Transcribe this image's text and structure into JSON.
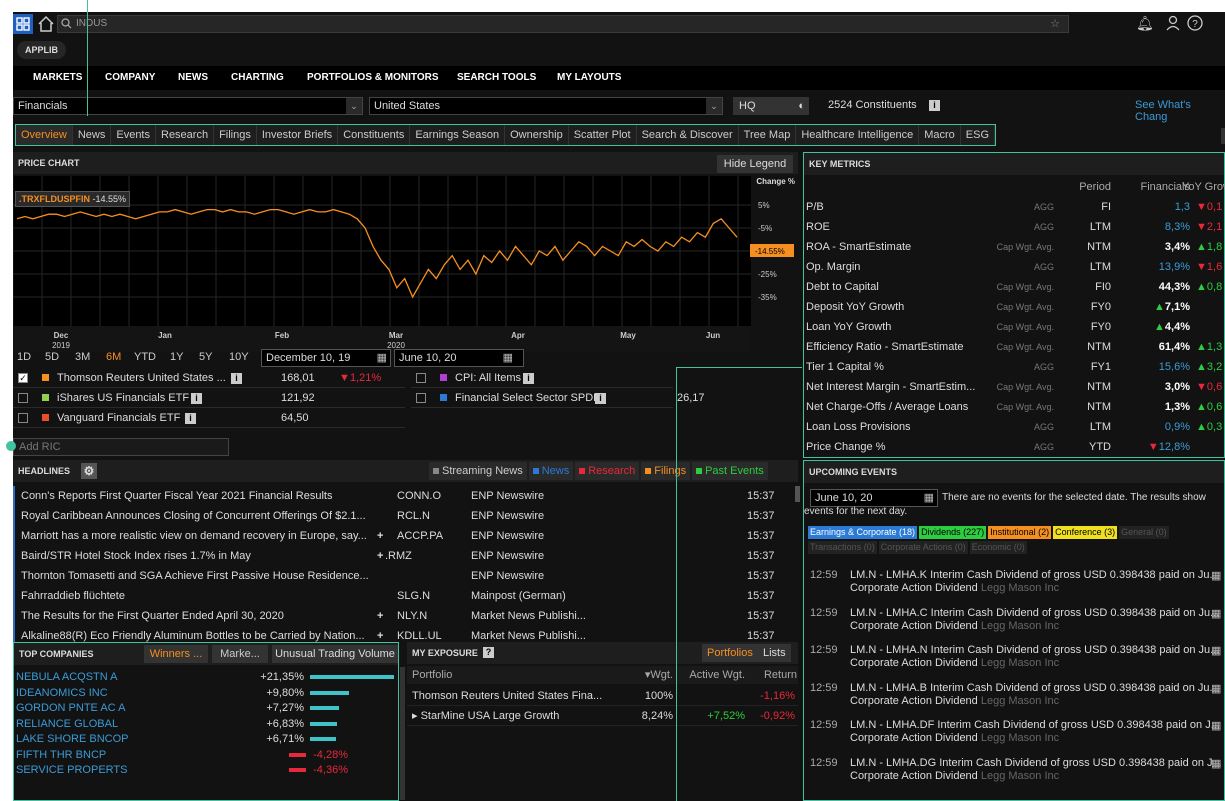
{
  "topbar": {
    "search_value": "INDUS"
  },
  "applib": "APPLIB",
  "mainnav": [
    "MARKETS",
    "COMPANY",
    "NEWS",
    "CHARTING",
    "PORTFOLIOS & MONITORS",
    "SEARCH TOOLS",
    "MY LAYOUTS"
  ],
  "filters": {
    "sector": "Financials",
    "country": "United States",
    "hq": "HQ",
    "constituents": "2524 Constituents",
    "see_whats_changed": "See What's Chang"
  },
  "tabs": [
    "Overview",
    "News",
    "Events",
    "Research",
    "Filings",
    "Investor Briefs",
    "Constituents",
    "Earnings Season",
    "Ownership",
    "Scatter Plot",
    "Search & Discover",
    "Tree Map",
    "Healthcare Intelligence",
    "Macro",
    "ESG"
  ],
  "price_chart": {
    "title": "PRICE CHART",
    "hide_legend": "Hide Legend",
    "change_label": "Change %",
    "ric_label": ".TRXFLDUSPFIN",
    "ric_change": "-14.55%",
    "current_value": "-14.55%",
    "y_ticks": [
      "5%",
      "-5%",
      "-14.55%",
      "-25%",
      "-35%"
    ],
    "x_ticks": [
      "Dec\n2019",
      "Jan",
      "Feb",
      "Mar\n2020",
      "Apr",
      "May",
      "Jun"
    ],
    "ranges": [
      "1D",
      "5D",
      "3M",
      "6M",
      "YTD",
      "1Y",
      "5Y",
      "10Y"
    ],
    "active_range": "6M",
    "date_from": "December 10, 19",
    "date_to": "June 10, 20",
    "add_ric_placeholder": "Add RIC",
    "legend": [
      {
        "name": "Thomson Reuters United States ...",
        "value": "168,01",
        "change": "1,21%",
        "color": "#f58f20",
        "checked": true
      },
      {
        "name": "iShares US Financials ETF",
        "value": "121,92",
        "change": "",
        "color": "#8fd14f",
        "checked": false
      },
      {
        "name": "Vanguard Financials ETF",
        "value": "64,50",
        "change": "",
        "color": "#e8502a",
        "checked": false
      },
      {
        "name": "CPI: All Items",
        "value": "",
        "change": "",
        "color": "#b040d0",
        "checked": false
      },
      {
        "name": "Financial Select Sector SPDR",
        "value": "26,17",
        "change": "",
        "color": "#2b7bd6",
        "checked": false
      }
    ]
  },
  "key_metrics": {
    "title": "KEY METRICS",
    "headers": [
      "Period",
      "Financials",
      "YoY Growt"
    ],
    "rows": [
      {
        "name": "P/B",
        "agg": "AGG",
        "period": "FI",
        "value": "1,3",
        "vc": "blue",
        "growth": "0,1",
        "gd": "down"
      },
      {
        "name": "ROE",
        "agg": "AGG",
        "period": "LTM",
        "value": "8,3%",
        "vc": "blue",
        "growth": "2,1",
        "gd": "down"
      },
      {
        "name": "ROA - SmartEstimate",
        "agg": "Cap Wgt. Avg.",
        "period": "NTM",
        "value": "3,4%",
        "vc": "white",
        "growth": "1,8",
        "gd": "up"
      },
      {
        "name": "Op. Margin",
        "agg": "AGG",
        "period": "LTM",
        "value": "13,9%",
        "vc": "blue",
        "growth": "1,6",
        "gd": "down"
      },
      {
        "name": "Debt to Capital",
        "agg": "Cap Wgt. Avg.",
        "period": "FI0",
        "value": "44,3%",
        "vc": "white",
        "growth": "0,8",
        "gd": "up"
      },
      {
        "name": "Deposit YoY Growth",
        "agg": "Cap Wgt. Avg.",
        "period": "FY0",
        "value": "7,1%",
        "vc": "white",
        "vd": "up",
        "growth": "",
        "gd": ""
      },
      {
        "name": "Loan YoY Growth",
        "agg": "Cap Wgt. Avg.",
        "period": "FY0",
        "value": "4,4%",
        "vc": "white",
        "vd": "up",
        "growth": "",
        "gd": ""
      },
      {
        "name": "Efficiency Ratio - SmartEstimate",
        "agg": "Cap Wgt. Avg.",
        "period": "NTM",
        "value": "61,4%",
        "vc": "white",
        "growth": "1,3",
        "gd": "up"
      },
      {
        "name": "Tier 1 Capital %",
        "agg": "AGG",
        "period": "FY1",
        "value": "15,6%",
        "vc": "blue",
        "growth": "3,2",
        "gd": "up"
      },
      {
        "name": "Net Interest Margin - SmartEstim...",
        "agg": "Cap Wgt. Avg.",
        "period": "NTM",
        "value": "3,0%",
        "vc": "white",
        "growth": "0,6",
        "gd": "down"
      },
      {
        "name": "Net Charge-Offs / Average Loans",
        "agg": "Cap Wgt. Avg.",
        "period": "NTM",
        "value": "1,3%",
        "vc": "white",
        "growth": "0,6",
        "gd": "up"
      },
      {
        "name": "Loan Loss Provisions",
        "agg": "AGG",
        "period": "LTM",
        "value": "0,9%",
        "vc": "blue",
        "growth": "0,3",
        "gd": "up"
      },
      {
        "name": "Price Change %",
        "agg": "AGG",
        "period": "YTD",
        "value": "12,8%",
        "vc": "blue",
        "vd": "down",
        "growth": "",
        "gd": ""
      }
    ]
  },
  "upcoming_events": {
    "title": "UPCOMING EVENTS",
    "date": "June 10, 20",
    "message": "There are no events for the selected date. The results show events for the next day.",
    "tags": [
      {
        "label": "Earnings & Corporate (18)",
        "bg": "#2b7bd6",
        "fg": "#fff"
      },
      {
        "label": "Dividends (227)",
        "bg": "#2ecc40",
        "fg": "#000"
      },
      {
        "label": "Institutional (2)",
        "bg": "#f58f20",
        "fg": "#000"
      },
      {
        "label": "Conference (3)",
        "bg": "#f0e020",
        "fg": "#000"
      },
      {
        "label": "General (0)",
        "bg": "#222",
        "fg": "#555"
      },
      {
        "label": "Transactions (0)",
        "bg": "#222",
        "fg": "#555"
      },
      {
        "label": "Corporate Actions (0)",
        "bg": "#222",
        "fg": "#555"
      },
      {
        "label": "Economic (0)",
        "bg": "#222",
        "fg": "#555"
      }
    ],
    "items": [
      {
        "time": "12:59",
        "desc": "LM.N - LMHA.K Interim Cash Dividend of gross USD 0.398438 paid on Ju...",
        "type": "Corporate Action Dividend",
        "company": "Legg Mason Inc"
      },
      {
        "time": "12:59",
        "desc": "LM.N - LMHA.C Interim Cash Dividend of gross USD 0.398438 paid on Ju...",
        "type": "Corporate Action Dividend",
        "company": "Legg Mason Inc"
      },
      {
        "time": "12:59",
        "desc": "LM.N - LMHA.N Interim Cash Dividend of gross USD 0.398438 paid on Ju...",
        "type": "Corporate Action Dividend",
        "company": "Legg Mason Inc"
      },
      {
        "time": "12:59",
        "desc": "LM.N - LMHA.B Interim Cash Dividend of gross USD 0.398438 paid on Ju...",
        "type": "Corporate Action Dividend",
        "company": "Legg Mason Inc"
      },
      {
        "time": "12:59",
        "desc": "LM.N - LMHA.DF Interim Cash Dividend of gross USD 0.398438 paid on J...",
        "type": "Corporate Action Dividend",
        "company": "Legg Mason Inc"
      },
      {
        "time": "12:59",
        "desc": "LM.N - LMHA.DG Interim Cash Dividend of gross USD 0.398438 paid on J...",
        "type": "Corporate Action Dividend",
        "company": "Legg Mason Inc"
      }
    ]
  },
  "headlines": {
    "title": "HEADLINES",
    "filters": [
      {
        "label": "Streaming News",
        "color": "#888"
      },
      {
        "label": "News",
        "color": "#2b7bd6"
      },
      {
        "label": "Research",
        "color": "#e8293a"
      },
      {
        "label": "Filings",
        "color": "#f58f20"
      },
      {
        "label": "Past Events",
        "color": "#2ecc40"
      }
    ],
    "rows": [
      {
        "title": "Conn's Reports First Quarter Fiscal Year 2021 Financial Results",
        "plus": "",
        "ric": "CONN.O",
        "source": "ENP Newswire",
        "time": "15:37"
      },
      {
        "title": "Royal Caribbean Announces Closing of Concurrent Offerings Of $2.1...",
        "plus": "",
        "ric": "RCL.N",
        "source": "ENP Newswire",
        "time": "15:37"
      },
      {
        "title": "Marriott has a more realistic view on demand recovery in Europe, say...",
        "plus": "+",
        "ric": "ACCP.PA",
        "source": "ENP Newswire",
        "time": "15:37"
      },
      {
        "title": "Baird/STR Hotel Stock Index rises 1.7% in May",
        "plus": "+",
        "ric": ".RMZ",
        "source": "ENP Newswire",
        "time": "15:37"
      },
      {
        "title": "Thornton Tomasetti and SGA Achieve First Passive House Residence...",
        "plus": "",
        "ric": "",
        "source": "ENP Newswire",
        "time": "15:37"
      },
      {
        "title": "Fahrraddieb flüchtete",
        "plus": "",
        "ric": "SLG.N",
        "source": "Mainpost (German)",
        "time": "15:37"
      },
      {
        "title": "The Results for the First Quarter Ended April 30, 2020",
        "plus": "+",
        "ric": "NLY.N",
        "source": "Market News Publishi...",
        "time": "15:37"
      },
      {
        "title": "Alkaline88(R) Eco Friendly Aluminum Bottles to be Carried by Nation...",
        "plus": "+",
        "ric": "KDLL.UL",
        "source": "Market News Publishi...",
        "time": "15:37"
      }
    ]
  },
  "top_companies": {
    "title": "TOP COMPANIES",
    "tabs": [
      "Winners ...",
      "Marke...",
      "Unusual Trading Volume"
    ],
    "rows": [
      {
        "name": "NEBULA ACQSTN A",
        "value": "+21,35%",
        "pct": 21.35
      },
      {
        "name": "IDEANOMICS INC",
        "value": "+9,80%",
        "pct": 9.8
      },
      {
        "name": "GORDON PNTE AC A",
        "value": "+7,27%",
        "pct": 7.27
      },
      {
        "name": "RELIANCE GLOBAL",
        "value": "+6,83%",
        "pct": 6.83
      },
      {
        "name": "LAKE SHORE BNCOP",
        "value": "+6,71%",
        "pct": 6.71
      },
      {
        "name": "FIFTH THR BNCP",
        "value": "-4,28%",
        "pct": -4.28
      },
      {
        "name": "SERVICE PROPERTS",
        "value": "-4,36%",
        "pct": -4.36
      }
    ]
  },
  "exposure": {
    "title": "MY EXPOSURE",
    "tabs": [
      "Portfolios",
      "Lists"
    ],
    "headers": [
      "Portfolio",
      "Wgt.",
      "Active Wgt.",
      "Return"
    ],
    "rows": [
      {
        "name": "Thomson Reuters United States Fina...",
        "wgt": "100%",
        "active": "",
        "ret": "-1,16%"
      },
      {
        "name": "▸ StarMine USA Large Growth",
        "wgt": "8,24%",
        "active": "+7,52%",
        "ret": "-0,92%"
      }
    ]
  }
}
